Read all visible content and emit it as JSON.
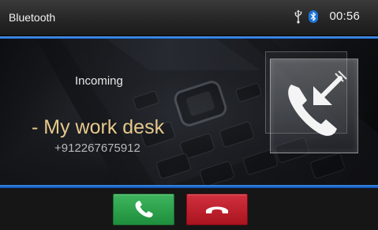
{
  "status_bar": {
    "title": "Bluetooth",
    "time": "00:56",
    "icons": [
      "usb-icon",
      "bluetooth-icon"
    ]
  },
  "call": {
    "status": "Incoming",
    "caller_name": "- My work desk",
    "caller_number": "+912267675912",
    "icon": "incoming-call-icon"
  },
  "actions": {
    "answer_icon": "answer-call-icon",
    "decline_icon": "end-call-icon"
  },
  "colors": {
    "accent_blue": "#2f7fe0",
    "answer_green": "#2ea44f",
    "decline_red": "#c0202c",
    "caller_name": "#e7c98c"
  }
}
